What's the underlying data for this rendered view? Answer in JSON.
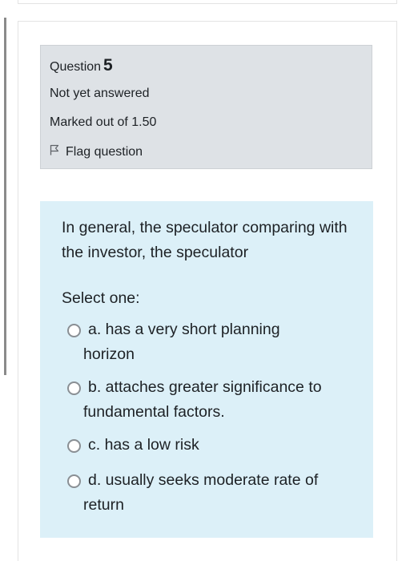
{
  "question": {
    "label": "Question",
    "number": "5",
    "state": "Not yet answered",
    "grade": "Marked out of 1.50",
    "flag_label": "Flag question"
  },
  "content": {
    "text": "In general, the speculator comparing with the investor, the speculator",
    "prompt": "Select one:",
    "options": [
      {
        "line1": "a. has a very short planning",
        "line2": "horizon"
      },
      {
        "line1": "b. attaches greater significance to",
        "line2": "fundamental factors."
      },
      {
        "line1": "c. has a low risk",
        "line2": ""
      },
      {
        "line1": "d. usually seeks moderate rate of",
        "line2": "return"
      }
    ]
  },
  "colors": {
    "info_bg": "#dee2e6",
    "content_bg": "#dcf0f8",
    "text": "#1d2125"
  },
  "icons": {
    "flag": "flag-icon",
    "radio": "radio-unchecked-icon"
  }
}
